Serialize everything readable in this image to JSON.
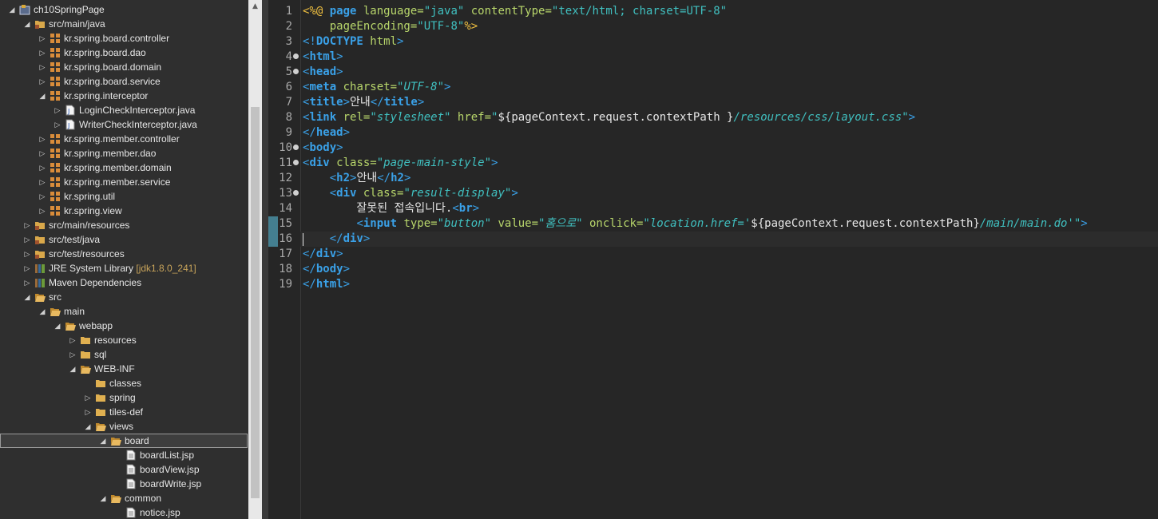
{
  "explorer": {
    "items": [
      {
        "label": "ch10SpringPage",
        "depth": 0,
        "arrow": "open",
        "icon": "project-icon"
      },
      {
        "label": "src/main/java",
        "depth": 1,
        "arrow": "open",
        "icon": "source-folder-icon"
      },
      {
        "label": "kr.spring.board.controller",
        "depth": 2,
        "arrow": "closed",
        "icon": "package-icon"
      },
      {
        "label": "kr.spring.board.dao",
        "depth": 2,
        "arrow": "closed",
        "icon": "package-icon"
      },
      {
        "label": "kr.spring.board.domain",
        "depth": 2,
        "arrow": "closed",
        "icon": "package-icon"
      },
      {
        "label": "kr.spring.board.service",
        "depth": 2,
        "arrow": "closed",
        "icon": "package-icon"
      },
      {
        "label": "kr.spring.interceptor",
        "depth": 2,
        "arrow": "open",
        "icon": "package-icon"
      },
      {
        "label": "LoginCheckInterceptor.java",
        "depth": 3,
        "arrow": "closed",
        "icon": "java-file-icon"
      },
      {
        "label": "WriterCheckInterceptor.java",
        "depth": 3,
        "arrow": "closed",
        "icon": "java-file-icon"
      },
      {
        "label": "kr.spring.member.controller",
        "depth": 2,
        "arrow": "closed",
        "icon": "package-icon"
      },
      {
        "label": "kr.spring.member.dao",
        "depth": 2,
        "arrow": "closed",
        "icon": "package-icon"
      },
      {
        "label": "kr.spring.member.domain",
        "depth": 2,
        "arrow": "closed",
        "icon": "package-icon"
      },
      {
        "label": "kr.spring.member.service",
        "depth": 2,
        "arrow": "closed",
        "icon": "package-icon"
      },
      {
        "label": "kr.spring.util",
        "depth": 2,
        "arrow": "closed",
        "icon": "package-icon"
      },
      {
        "label": "kr.spring.view",
        "depth": 2,
        "arrow": "closed",
        "icon": "package-icon"
      },
      {
        "label": "src/main/resources",
        "depth": 1,
        "arrow": "closed",
        "icon": "source-folder-icon"
      },
      {
        "label": "src/test/java",
        "depth": 1,
        "arrow": "closed",
        "icon": "source-folder-icon"
      },
      {
        "label": "src/test/resources",
        "depth": 1,
        "arrow": "closed",
        "icon": "source-folder-icon"
      },
      {
        "label": "JRE System Library",
        "suffix": "[jdk1.8.0_241]",
        "depth": 1,
        "arrow": "closed",
        "icon": "library-icon"
      },
      {
        "label": "Maven Dependencies",
        "depth": 1,
        "arrow": "closed",
        "icon": "library-icon"
      },
      {
        "label": "src",
        "depth": 1,
        "arrow": "open",
        "icon": "folder-open-icon"
      },
      {
        "label": "main",
        "depth": 2,
        "arrow": "open",
        "icon": "folder-open-icon"
      },
      {
        "label": "webapp",
        "depth": 3,
        "arrow": "open",
        "icon": "folder-open-icon"
      },
      {
        "label": "resources",
        "depth": 4,
        "arrow": "closed",
        "icon": "folder-icon"
      },
      {
        "label": "sql",
        "depth": 4,
        "arrow": "closed",
        "icon": "folder-icon"
      },
      {
        "label": "WEB-INF",
        "depth": 4,
        "arrow": "open",
        "icon": "folder-open-icon"
      },
      {
        "label": "classes",
        "depth": 5,
        "arrow": "none",
        "icon": "folder-icon"
      },
      {
        "label": "spring",
        "depth": 5,
        "arrow": "closed",
        "icon": "folder-icon"
      },
      {
        "label": "tiles-def",
        "depth": 5,
        "arrow": "closed",
        "icon": "folder-icon"
      },
      {
        "label": "views",
        "depth": 5,
        "arrow": "open",
        "icon": "folder-open-icon"
      },
      {
        "label": "board",
        "depth": 6,
        "arrow": "open",
        "icon": "folder-open-icon",
        "selected": true
      },
      {
        "label": "boardList.jsp",
        "depth": 7,
        "arrow": "none",
        "icon": "jsp-file-icon"
      },
      {
        "label": "boardView.jsp",
        "depth": 7,
        "arrow": "none",
        "icon": "jsp-file-icon"
      },
      {
        "label": "boardWrite.jsp",
        "depth": 7,
        "arrow": "none",
        "icon": "jsp-file-icon"
      },
      {
        "label": "common",
        "depth": 6,
        "arrow": "open",
        "icon": "folder-open-icon"
      },
      {
        "label": "notice.jsp",
        "depth": 7,
        "arrow": "none",
        "icon": "jsp-file-icon"
      }
    ]
  },
  "editor": {
    "current_line": 16,
    "fold_lines": [
      4,
      5,
      10,
      11,
      13
    ],
    "change_marks": [
      15,
      16
    ],
    "lines": [
      [
        [
          "jsp",
          "<%@ "
        ],
        [
          "tagb",
          "page "
        ],
        [
          "attr",
          "language="
        ],
        [
          "str",
          "\"java\" "
        ],
        [
          "attr",
          "contentType="
        ],
        [
          "str",
          "\"text/html; charset=UTF-8\""
        ]
      ],
      [
        [
          "text",
          "    "
        ],
        [
          "attr",
          "pageEncoding="
        ],
        [
          "str",
          "\"UTF-8\""
        ],
        [
          "jsp",
          "%>"
        ]
      ],
      [
        [
          "tag",
          "<!"
        ],
        [
          "tagb",
          "DOCTYPE "
        ],
        [
          "attr",
          "html"
        ],
        [
          "tag",
          ">"
        ]
      ],
      [
        [
          "tag",
          "<"
        ],
        [
          "tagb",
          "html"
        ],
        [
          "tag",
          ">"
        ]
      ],
      [
        [
          "tag",
          "<"
        ],
        [
          "tagb",
          "head"
        ],
        [
          "tag",
          ">"
        ]
      ],
      [
        [
          "tag",
          "<"
        ],
        [
          "tagb",
          "meta "
        ],
        [
          "attr",
          "charset="
        ],
        [
          "stri",
          "\"UTF-8\""
        ],
        [
          "tag",
          ">"
        ]
      ],
      [
        [
          "tag",
          "<"
        ],
        [
          "tagb",
          "title"
        ],
        [
          "tag",
          ">"
        ],
        [
          "text",
          "안내"
        ],
        [
          "tag",
          "</"
        ],
        [
          "tagb",
          "title"
        ],
        [
          "tag",
          ">"
        ]
      ],
      [
        [
          "tag",
          "<"
        ],
        [
          "tagb",
          "link "
        ],
        [
          "attr",
          "rel="
        ],
        [
          "stri",
          "\"stylesheet\" "
        ],
        [
          "attr",
          "href="
        ],
        [
          "stri",
          "\""
        ],
        [
          "text",
          "${pageContext.request.contextPath }"
        ],
        [
          "stri",
          "/resources/css/layout.css\""
        ],
        [
          "tag",
          ">"
        ]
      ],
      [
        [
          "tag",
          "</"
        ],
        [
          "tagb",
          "head"
        ],
        [
          "tag",
          ">"
        ]
      ],
      [
        [
          "tag",
          "<"
        ],
        [
          "tagb",
          "body"
        ],
        [
          "tag",
          ">"
        ]
      ],
      [
        [
          "tag",
          "<"
        ],
        [
          "tagb",
          "div "
        ],
        [
          "attr",
          "class="
        ],
        [
          "stri",
          "\"page-main-style\""
        ],
        [
          "tag",
          ">"
        ]
      ],
      [
        [
          "text",
          "    "
        ],
        [
          "tag",
          "<"
        ],
        [
          "tagb",
          "h2"
        ],
        [
          "tag",
          ">"
        ],
        [
          "text",
          "안내"
        ],
        [
          "tag",
          "</"
        ],
        [
          "tagb",
          "h2"
        ],
        [
          "tag",
          ">"
        ]
      ],
      [
        [
          "text",
          "    "
        ],
        [
          "tag",
          "<"
        ],
        [
          "tagb",
          "div "
        ],
        [
          "attr",
          "class="
        ],
        [
          "stri",
          "\"result-display\""
        ],
        [
          "tag",
          ">"
        ]
      ],
      [
        [
          "text",
          "        잘못된 접속입니다."
        ],
        [
          "tag",
          "<"
        ],
        [
          "tagb",
          "br"
        ],
        [
          "tag",
          ">"
        ]
      ],
      [
        [
          "text",
          "        "
        ],
        [
          "tag",
          "<"
        ],
        [
          "tagb",
          "input "
        ],
        [
          "attr",
          "type="
        ],
        [
          "stri",
          "\"button\" "
        ],
        [
          "attr",
          "value="
        ],
        [
          "stri",
          "\"홈으로\" "
        ],
        [
          "attr",
          "onclick="
        ],
        [
          "stri",
          "\"location.href='"
        ],
        [
          "text",
          "${pageContext.request.contextPath}"
        ],
        [
          "stri",
          "/main/main.do'\""
        ],
        [
          "tag",
          ">"
        ]
      ],
      [
        [
          "text",
          "    "
        ],
        [
          "tag",
          "</"
        ],
        [
          "tagb",
          "div"
        ],
        [
          "tag",
          ">"
        ]
      ],
      [
        [
          "tag",
          "</"
        ],
        [
          "tagb",
          "div"
        ],
        [
          "tag",
          ">"
        ]
      ],
      [
        [
          "tag",
          "</"
        ],
        [
          "tagb",
          "body"
        ],
        [
          "tag",
          ">"
        ]
      ],
      [
        [
          "tag",
          "</"
        ],
        [
          "tagb",
          "html"
        ],
        [
          "tag",
          ">"
        ]
      ]
    ]
  }
}
